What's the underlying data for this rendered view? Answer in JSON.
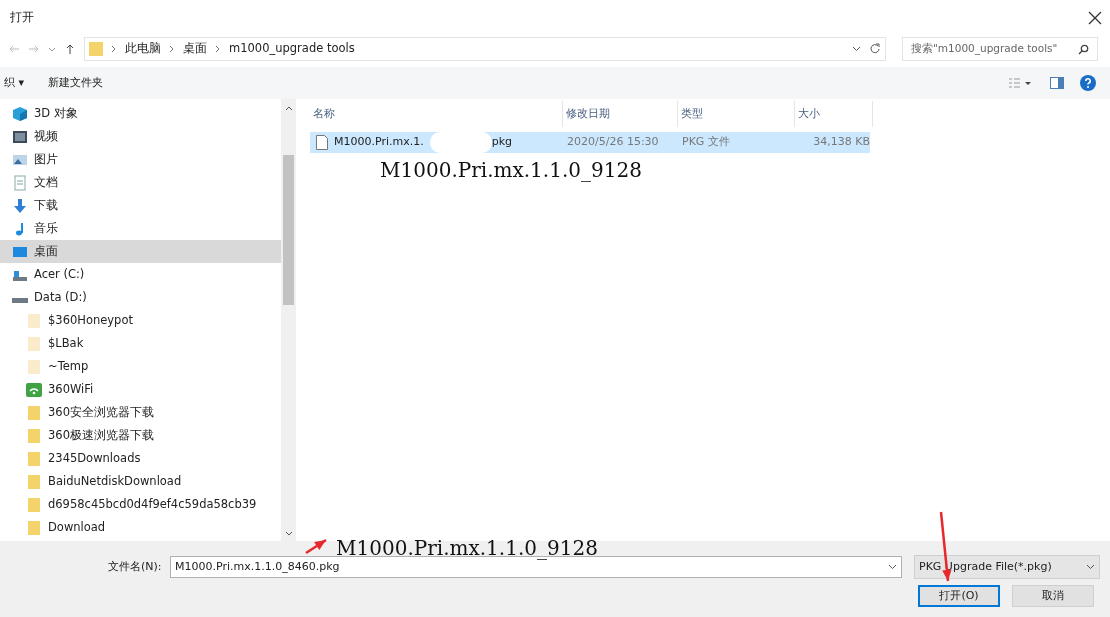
{
  "window": {
    "title": "打开"
  },
  "address": {
    "crumbs": [
      "此电脑",
      "桌面",
      "m1000_upgrade tools"
    ],
    "search_placeholder": "搜索\"m1000_upgrade tools\""
  },
  "toolbar": {
    "organize": "织 ▾",
    "new_folder": "新建文件夹"
  },
  "sidebar": {
    "items": [
      {
        "label": "3D 对象",
        "kind": "object",
        "selected": false
      },
      {
        "label": "视频",
        "kind": "video",
        "selected": false
      },
      {
        "label": "图片",
        "kind": "pictures",
        "selected": false
      },
      {
        "label": "文档",
        "kind": "documents",
        "selected": false
      },
      {
        "label": "下载",
        "kind": "downloads",
        "selected": false
      },
      {
        "label": "音乐",
        "kind": "music",
        "selected": false
      },
      {
        "label": "桌面",
        "kind": "desktop",
        "selected": true
      },
      {
        "label": "Acer (C:)",
        "kind": "system",
        "selected": false
      },
      {
        "label": "Data (D:)",
        "kind": "drive",
        "selected": false,
        "children": [
          {
            "label": "$360Honeypot",
            "kind": "folder-faded",
            "selected": false
          },
          {
            "label": "$LBak",
            "kind": "folder-faded",
            "selected": false
          },
          {
            "label": "~Temp",
            "kind": "folder-faded",
            "selected": false
          },
          {
            "label": "360WiFi",
            "kind": "wifi",
            "selected": false
          },
          {
            "label": "360安全浏览器下载",
            "kind": "folder",
            "selected": false
          },
          {
            "label": "360极速浏览器下载",
            "kind": "folder",
            "selected": false
          },
          {
            "label": "2345Downloads",
            "kind": "folder",
            "selected": false
          },
          {
            "label": "BaiduNetdiskDownload",
            "kind": "folder",
            "selected": false
          },
          {
            "label": "d6958c45bcd0d4f9ef4c59da58cb39",
            "kind": "folder",
            "selected": false
          },
          {
            "label": "Download",
            "kind": "folder",
            "selected": false
          }
        ]
      }
    ]
  },
  "table": {
    "columns": [
      "名称",
      "修改日期",
      "类型",
      "大小"
    ],
    "rows": [
      {
        "name": "M1000.Pri.mx.1.",
        "name_tail": "pkg",
        "date": "2020/5/26 15:30",
        "type": "PKG 文件",
        "size": "34,138 KB",
        "selected": true
      }
    ]
  },
  "annotations": [
    "M1000.Pri.mx.1.1.0_9128",
    "M1000.Pri.mx.1.1.0_9128"
  ],
  "footer": {
    "filename_label": "文件名(N):",
    "filename": "M1000.Pri.mx.1.1.0_8460.pkg",
    "filter": "PKG Upgrade File(*.pkg)",
    "open": "打开(O)",
    "cancel": "取消"
  }
}
